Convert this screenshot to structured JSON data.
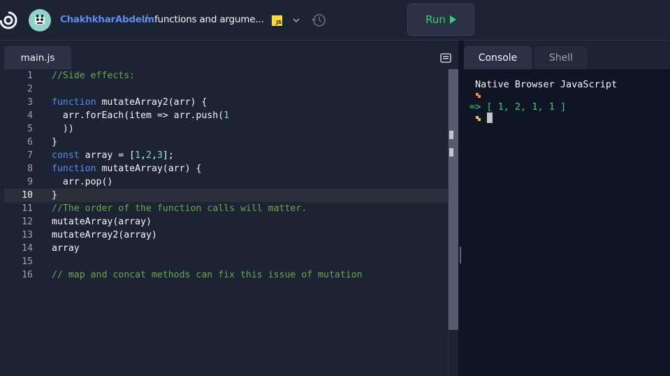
{
  "header": {
    "username": "ChakhkharAbdelm",
    "separator": "/",
    "repl_name": "functions and argume...",
    "language_badge": "JS",
    "run_label": "Run"
  },
  "editor": {
    "file_tab": "main.js",
    "active_line": 10,
    "lines": [
      {
        "n": "1",
        "text": "//Side effects:"
      },
      {
        "n": "2",
        "text": ""
      },
      {
        "n": "3",
        "text": "function mutateArray2(arr) {"
      },
      {
        "n": "4",
        "text": "  arr.forEach(item => arr.push(1"
      },
      {
        "n": "5",
        "text": "  ))"
      },
      {
        "n": "6",
        "text": "}"
      },
      {
        "n": "7",
        "text": "const array = [1,2,3];"
      },
      {
        "n": "8",
        "text": "function mutateArray(arr) {"
      },
      {
        "n": "9",
        "text": "  arr.pop()"
      },
      {
        "n": "10",
        "text": "}"
      },
      {
        "n": "11",
        "text": "//The order of the function calls will matter."
      },
      {
        "n": "12",
        "text": "mutateArray(array)"
      },
      {
        "n": "13",
        "text": "mutateArray2(array)"
      },
      {
        "n": "14",
        "text": "array"
      },
      {
        "n": "15",
        "text": ""
      },
      {
        "n": "16",
        "text": "// map and concat methods can fix this issue of mutation"
      }
    ]
  },
  "console_panel": {
    "tabs": [
      "Console",
      "Shell"
    ],
    "active_tab": "Console",
    "title": "Native Browser JavaScript",
    "result_arrow": "=>",
    "result": "[ 1, 2, 1, 1 ]"
  },
  "colors": {
    "background": "#1c2333",
    "console_bg": "#0e1525",
    "username": "#5d8bf4",
    "run_green": "#2fd36c",
    "comment": "#6aa84f",
    "keyword": "#5d8bf4",
    "number": "#8fd3c9",
    "prompt_orange": "#ff8c2e",
    "prompt_yellow": "#f7c33b"
  },
  "icons": [
    "replit-logo-icon",
    "avatar-icon",
    "js-badge-icon",
    "chevron-down-icon",
    "history-icon",
    "play-icon",
    "panel-layout-icon"
  ]
}
